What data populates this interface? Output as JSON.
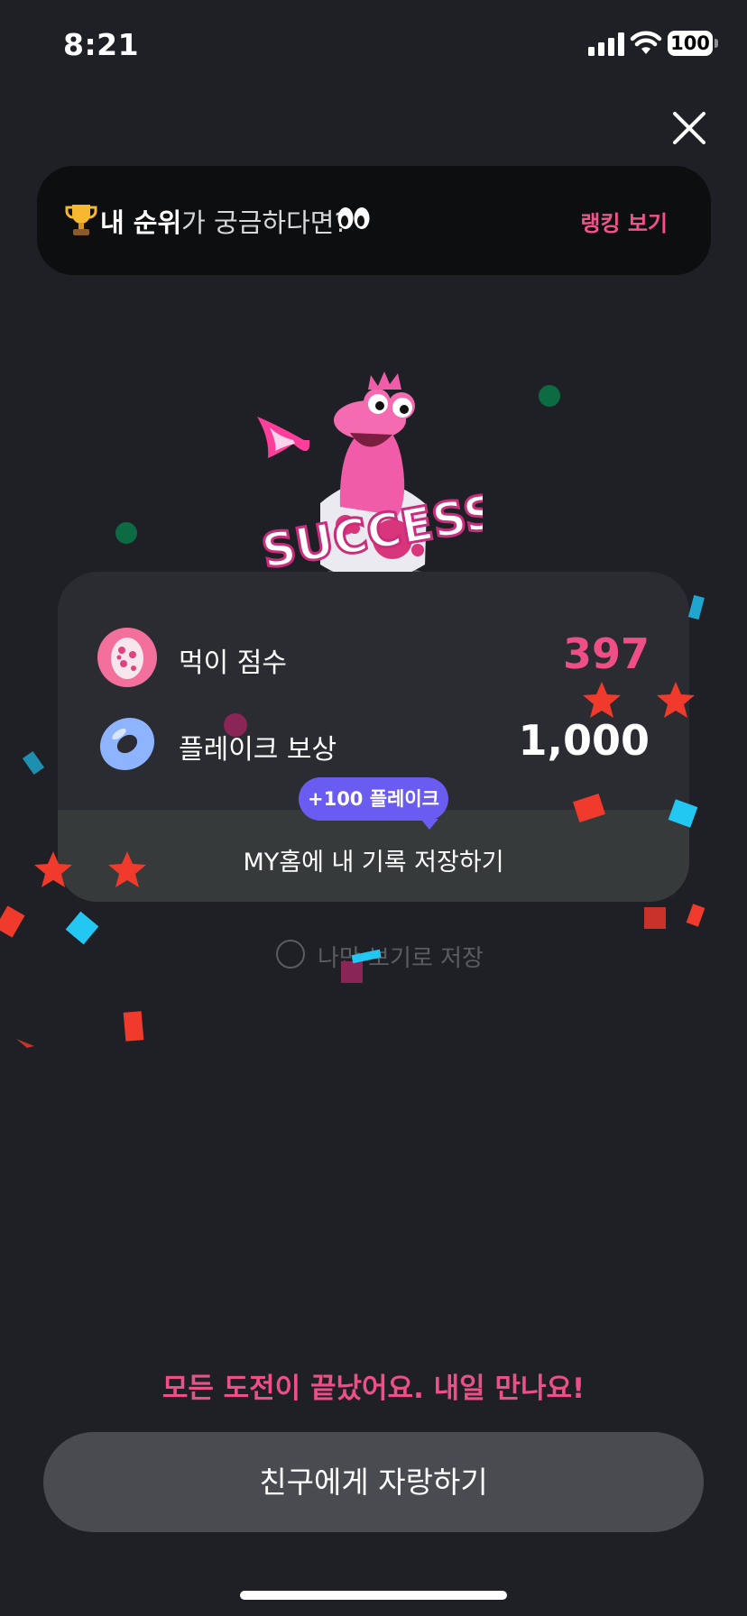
{
  "status_bar": {
    "time": "8:21",
    "battery": "100"
  },
  "rank_banner": {
    "bold_text": "내 순위",
    "rest_text": "가 궁금하다면?",
    "link_label": "랭킹 보기"
  },
  "mascot": {
    "badge_text": "SUCCESS"
  },
  "result_card": {
    "score_label": "먹이 점수",
    "score_value": "397",
    "reward_label": "플레이크 보상",
    "reward_value": "1,000",
    "bonus_badge": "+100 플레이크",
    "save_label": "MY홈에 내 기록 저장하기"
  },
  "private_toggle": {
    "label": "나만 보기로 저장",
    "checked": false
  },
  "footer": {
    "message": "모든 도전이 끝났어요. 내일 만나요!",
    "share_button": "친구에게 자랑하기"
  },
  "colors": {
    "background": "#1f2025",
    "accent_pink": "#ef4f87",
    "bubble_purple": "#6a5cf0",
    "card": "#2b2c31"
  }
}
